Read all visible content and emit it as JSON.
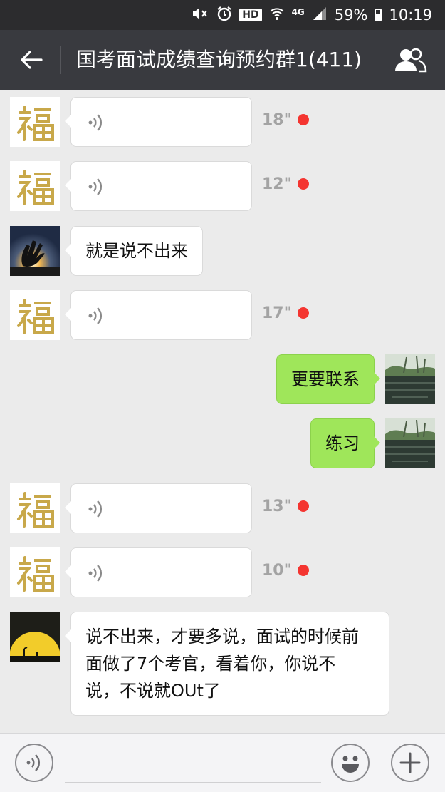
{
  "status_bar": {
    "hd": "HD",
    "network": "4G",
    "battery": "59%",
    "time": "10:19",
    "icons": [
      "mute-vibrate-icon",
      "alarm-icon",
      "wifi-icon",
      "signal-icon",
      "battery-icon"
    ]
  },
  "header": {
    "title": "国考面试成绩查询预约群1(411)",
    "back_icon": "arrow-left-icon",
    "members_icon": "group-members-icon"
  },
  "messages": [
    {
      "type": "voice",
      "direction": "in",
      "avatar": "fu-avatar",
      "duration": "18\"",
      "unread": true
    },
    {
      "type": "voice",
      "direction": "in",
      "avatar": "fu-avatar",
      "duration": "12\"",
      "unread": true
    },
    {
      "type": "text",
      "direction": "in",
      "avatar": "hand-sunset-avatar",
      "text": "就是说不出来"
    },
    {
      "type": "voice",
      "direction": "in",
      "avatar": "fu-avatar",
      "duration": "17\"",
      "unread": true
    },
    {
      "type": "text",
      "direction": "out",
      "avatar": "lake-avatar",
      "text": "更要联系"
    },
    {
      "type": "text",
      "direction": "out",
      "avatar": "lake-avatar",
      "text": "练习"
    },
    {
      "type": "voice",
      "direction": "in",
      "avatar": "fu-avatar",
      "duration": "13\"",
      "unread": true
    },
    {
      "type": "voice",
      "direction": "in",
      "avatar": "fu-avatar",
      "duration": "10\"",
      "unread": true
    },
    {
      "type": "text",
      "direction": "in",
      "avatar": "yellow-sunset-avatar",
      "text": "说不出来，才要多说，面试的时候前\n面做了7个考官，看着你，你说不\n说，不说就OUt了"
    }
  ],
  "input_bar": {
    "voice_icon": "voice-input-icon",
    "emoji_icon": "emoji-icon",
    "plus_icon": "plus-icon",
    "value": ""
  },
  "colors": {
    "status_bar": "#2c2c2e",
    "title_bar": "#393a3f",
    "chat_bg": "#ebebeb",
    "outgoing_bubble": "#9fe65a",
    "unread_dot": "#f43530",
    "fu_gold": "#c8a84a"
  }
}
